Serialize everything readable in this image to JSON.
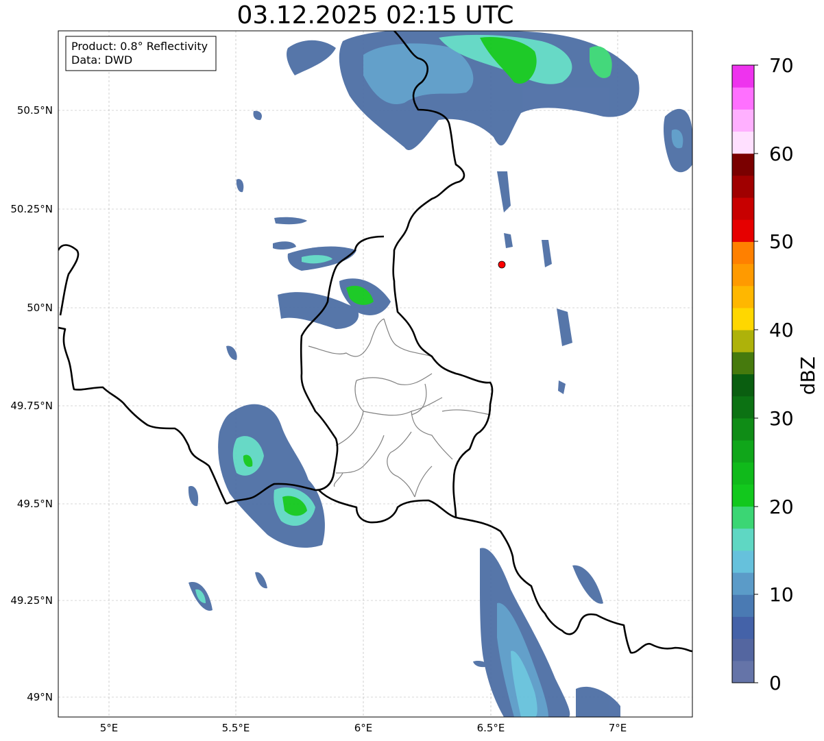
{
  "title": "03.12.2025 02:15 UTC",
  "info": {
    "product": "Product: 0.8° Reflectivity",
    "source": "Data: DWD"
  },
  "lat_labels": [
    "50.5°N",
    "50.25°N",
    "50°N",
    "49.75°N",
    "49.5°N",
    "49.25°N",
    "49°N"
  ],
  "lon_labels": [
    "5°E",
    "5.5°E",
    "6°E",
    "6.5°E",
    "7°E"
  ],
  "colorbar": {
    "unit": "dBZ",
    "tick_labels": [
      "0",
      "10",
      "20",
      "30",
      "40",
      "50",
      "60",
      "70"
    ],
    "min": 0,
    "max": 70,
    "colors": [
      "#6574a8",
      "#5466a0",
      "#4462a8",
      "#4a7ab3",
      "#5b9bc8",
      "#66c1dc",
      "#5fd7c3",
      "#3bd674",
      "#12c81d",
      "#10ba1b",
      "#10a61a",
      "#0f8c16",
      "#0c7213",
      "#0a5e10",
      "#467a0d",
      "#aeb20a",
      "#ffd700",
      "#ffb700",
      "#ff9a00",
      "#ff8000",
      "#e60000",
      "#c80000",
      "#a00000",
      "#7a0000",
      "#ffe0ff",
      "#ffb0ff",
      "#ff70ff",
      "#ee33ee"
    ]
  },
  "site_marker": {
    "color": "#ff0000",
    "lon": 6.55,
    "lat": 50.11
  },
  "colors": {
    "border": "#000000",
    "admin": "#808080",
    "grid": "#b0b0b0"
  }
}
